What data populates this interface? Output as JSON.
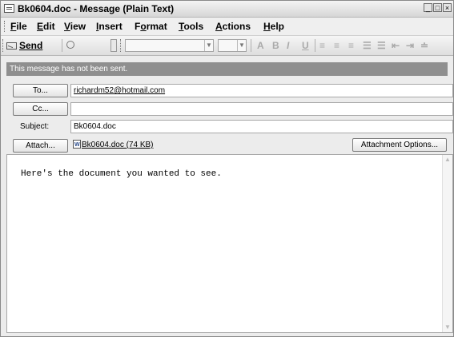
{
  "window": {
    "title": "Bk0604.doc - Message (Plain Text)"
  },
  "menu": {
    "items": [
      {
        "label": "File",
        "accel": "F",
        "rest": "ile"
      },
      {
        "label": "Edit",
        "accel": "E",
        "rest": "dit"
      },
      {
        "label": "View",
        "accel": "V",
        "rest": "iew"
      },
      {
        "label": "Insert",
        "accel": "I",
        "rest": "nsert"
      },
      {
        "label": "Format",
        "accel": "o",
        "pre": "F",
        "rest": "rmat"
      },
      {
        "label": "Tools",
        "accel": "T",
        "rest": "ools"
      },
      {
        "label": "Actions",
        "accel": "A",
        "rest": "ctions"
      },
      {
        "label": "Help",
        "accel": "H",
        "rest": "elp"
      }
    ]
  },
  "toolbar": {
    "send_label": "Send"
  },
  "infobar": {
    "text": "This message has not been sent."
  },
  "fields": {
    "to_label": "To...",
    "to_value": "richardm52@hotmail.com",
    "cc_label": "Cc...",
    "cc_value": "",
    "subject_label": "Subject:",
    "subject_value": "Bk0604.doc",
    "attach_label": "Attach...",
    "attachment_name": "Bk0604.doc (74 KB)",
    "attachment_options_label": "Attachment Options..."
  },
  "message": {
    "body": "Here's the document you wanted to see."
  }
}
